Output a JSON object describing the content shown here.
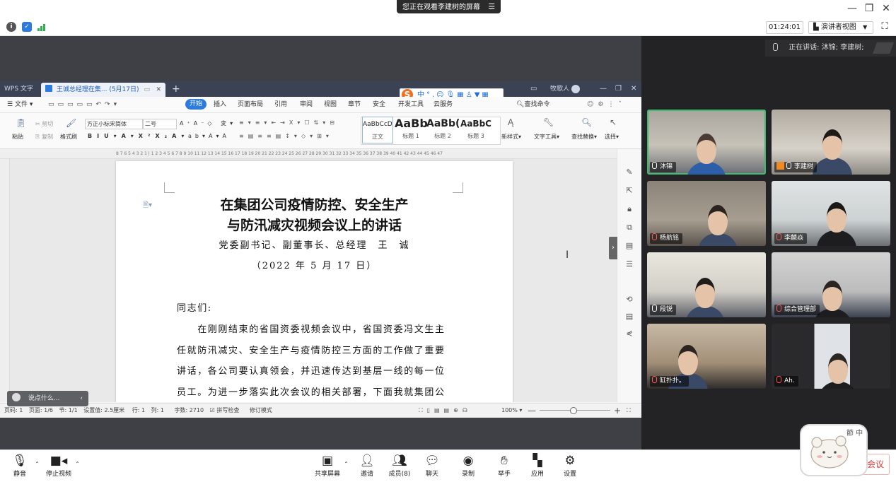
{
  "top_bar": {
    "banner_text": "您正在观看李建树的屏幕",
    "banner_icon": "list-icon",
    "window_controls": [
      "minimize-icon",
      "restore-icon",
      "close-icon"
    ]
  },
  "meeting_toolbar": {
    "status_icons": [
      "info-icon",
      "shield-icon",
      "signal-icon"
    ],
    "timer": "01:24:01",
    "view_mode": "演讲者视图",
    "fullscreen_icon": "fullscreen-icon"
  },
  "speaking": {
    "label": "正在讲话: 沐锦; 李建树;"
  },
  "participants": [
    {
      "name": "沐锦",
      "muted": false
    },
    {
      "name": "李建树",
      "muted": false
    },
    {
      "name": "杨航铭",
      "muted": true
    },
    {
      "name": "李麟焱",
      "muted": true
    },
    {
      "name": "段锐",
      "muted": false
    },
    {
      "name": "综合管理部",
      "muted": true
    },
    {
      "name": "缸扑扑。",
      "muted": true
    },
    {
      "name": "Ah.",
      "muted": true
    }
  ],
  "wps": {
    "app_tab": "WPS 文字",
    "doc_tab": "王诚总经理在集... (5月17日)",
    "user": "牧歌人",
    "menu": {
      "file": "文件",
      "tabs": [
        "开始",
        "插入",
        "页面布局",
        "引用",
        "审阅",
        "视图",
        "章节",
        "安全",
        "开发工具",
        "云服务"
      ],
      "active_tab": "开始",
      "search": "查找命令"
    },
    "ribbon": {
      "cut": "剪切",
      "copy": "复制",
      "paste": "粘贴",
      "format_painter": "格式刷",
      "font_name": "方正小标宋简体",
      "font_size": "二号",
      "styles": [
        {
          "preview": "AaBbCcDd",
          "label": "正文"
        },
        {
          "preview": "AaBb",
          "label": "标题 1"
        },
        {
          "preview": "AaBb(",
          "label": "标题 2"
        },
        {
          "preview": "AaBbC",
          "label": "标题 3"
        }
      ],
      "new_style": "新样式",
      "text_tools": "文字工具",
      "find_replace": "查找替换",
      "select": "选择"
    },
    "ruler_text": "8 7 6 5 4 3 2 1 | 1 2 3 4 5 6 7 8 9 10 11 12 13 14 15 16 17 18 19 20 21 22 23 24 25 26 27 28 29 30 31 32 33 34 35 36 37 38 39 40 41 42 43 44 45 46 47",
    "document": {
      "title_line1": "在集团公司疫情防控、安全生产",
      "title_line2": "与防汛减灾视频会议上的讲话",
      "author": "党委副书记、副董事长、总经理　王　诚",
      "date": "（2022 年 5 月 17 日）",
      "salutation": "同志们:",
      "body_lines": [
        "　　在刚刚结束的省国资委视频会议中，省国资委冯文生主",
        "任就防汛减灾、安全生产与疫情防控三方面的工作做了重要",
        "讲话，各公司要认真领会，并迅速传达到基层一线的每一位",
        "员工。为进一步落实此次会议的相关部署，下面我就集团公"
      ]
    },
    "comment_placeholder": "说点什么...",
    "status": {
      "page": "页码: 1",
      "pages": "页面: 1/6",
      "section": "节: 1/1",
      "setting": "设置值: 2.5厘米",
      "row": "行: 1",
      "col": "列: 1",
      "words": "字数: 2710",
      "spell": "拼写检查",
      "revision": "修订模式",
      "zoom": "100%"
    }
  },
  "bottom_bar": {
    "mute": "静音",
    "stop_video": "停止视频",
    "share_screen": "共享屏幕",
    "invite": "邀请",
    "members": "成员(8)",
    "chat": "聊天",
    "record": "录制",
    "raise_hand": "举手",
    "apps": "应用",
    "settings": "设置",
    "leave": "会议"
  },
  "sticker_text": "節 中",
  "colors": {
    "accent": "#2b7be0",
    "active_speaker_border": "#3dbb6e",
    "leave_red": "#e03a3a",
    "shared_bg": "#3f4045",
    "panel_bg": "#232325"
  }
}
